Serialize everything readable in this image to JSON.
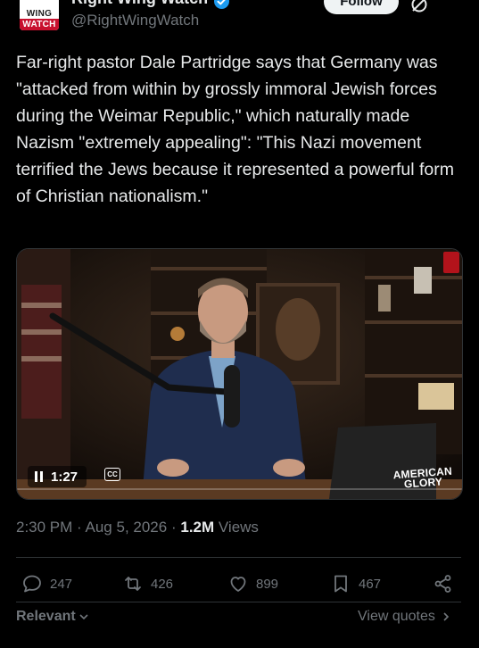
{
  "colors": {
    "background": "#000000",
    "text": "#e7e9ea",
    "secondary": "#71767b",
    "verified_blue": "#1d9bf0",
    "logo_red": "#c8102e"
  },
  "header": {
    "logo_line1": "WING",
    "logo_line2": "WATCH",
    "display_name": "Right Wing Watch",
    "handle": "@RightWingWatch",
    "follow_label": "Follow"
  },
  "tweet": {
    "text": "Far-right pastor Dale Partridge says that Germany was \"attacked from within by grossly immoral Jewish forces during the Weimar Republic,\" which naturally made Nazism \"extremely appealing\": \"This Nazi movement terrified the Jews because it represented a powerful form of Christian nationalism.\""
  },
  "video": {
    "timestamp": "1:27",
    "cc_label": "CC",
    "watermark_line1": "AMERICAN",
    "watermark_line2": "GLORY"
  },
  "meta": {
    "time": "2:30 PM",
    "separator": "·",
    "date": "Aug 5, 2026",
    "views_count": "1.2M",
    "views_label": "Views"
  },
  "actions": {
    "replies": "247",
    "reposts": "426",
    "likes": "899",
    "bookmarks": "467"
  },
  "bottom": {
    "sort_label": "Relevant",
    "quotes_label": "View quotes"
  },
  "icons": [
    "verified-badge-icon",
    "grok-icon",
    "more-icon",
    "pause-icon",
    "cc-icon",
    "reply-icon",
    "repost-icon",
    "like-icon",
    "bookmark-icon",
    "share-icon",
    "chevron-down-icon",
    "chevron-right-icon"
  ]
}
